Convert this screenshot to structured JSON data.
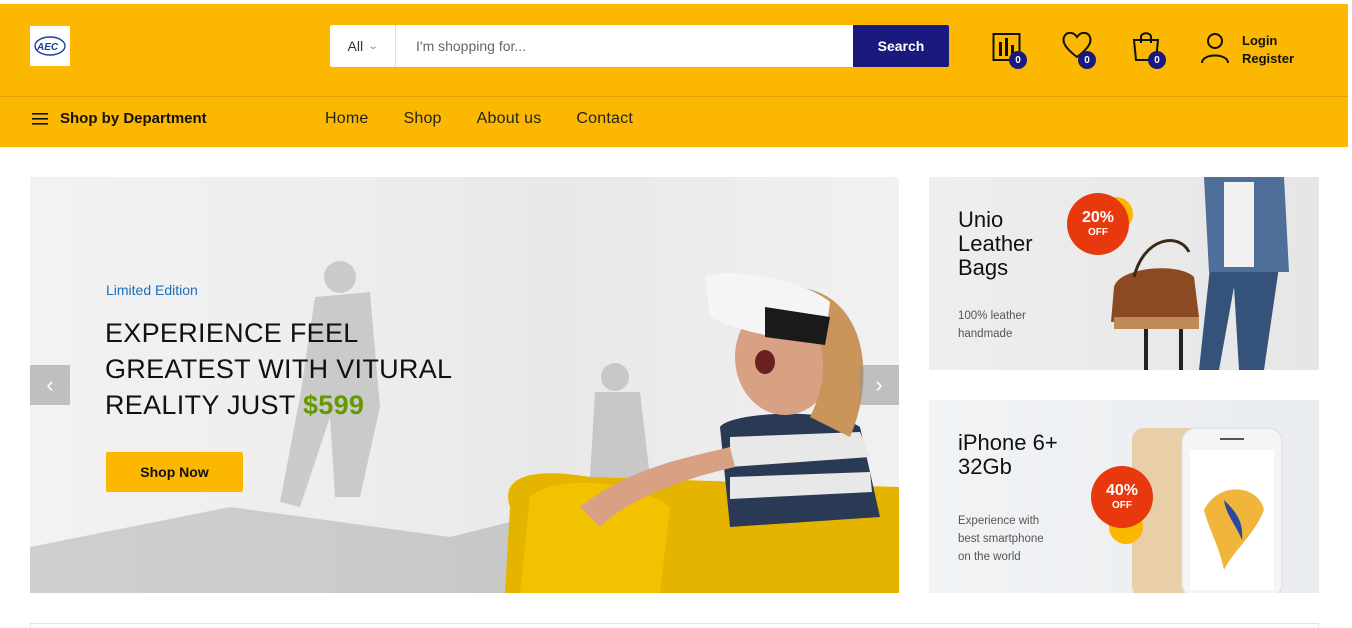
{
  "brand": {
    "logo_text": "AEC"
  },
  "search": {
    "category": "All",
    "placeholder": "I'm shopping for...",
    "button_label": "Search"
  },
  "header_icons": {
    "compare_count": "0",
    "wishlist_count": "0",
    "cart_count": "0"
  },
  "account": {
    "login": "Login",
    "register": "Register"
  },
  "nav": {
    "department_label": "Shop by Department",
    "items": [
      {
        "label": "Home"
      },
      {
        "label": "Shop"
      },
      {
        "label": "About us"
      },
      {
        "label": "Contact"
      }
    ]
  },
  "hero": {
    "tag": "Limited Edition",
    "title_line1": "EXPERIENCE FEEL",
    "title_line2": "GREATEST WITH VITURAL",
    "title_line3": "REALITY JUST",
    "price": "$599",
    "button_label": "Shop Now"
  },
  "promos": [
    {
      "title_line1": "Unio",
      "title_line2": "Leather",
      "title_line3": "Bags",
      "desc_line1": "100% leather",
      "desc_line2": "handmade",
      "discount": "20%",
      "off": "OFF"
    },
    {
      "title_line1": "iPhone 6+",
      "title_line2": "32Gb",
      "desc_line1": "Experience with",
      "desc_line2": "best smartphone",
      "desc_line3": "on the world",
      "discount": "40%",
      "off": "OFF"
    }
  ],
  "colors": {
    "brand_yellow": "#fcb800",
    "navy": "#1a1a7e",
    "sale_red": "#e8380d",
    "price_green": "#669900",
    "tag_blue": "#1e6fb8"
  }
}
